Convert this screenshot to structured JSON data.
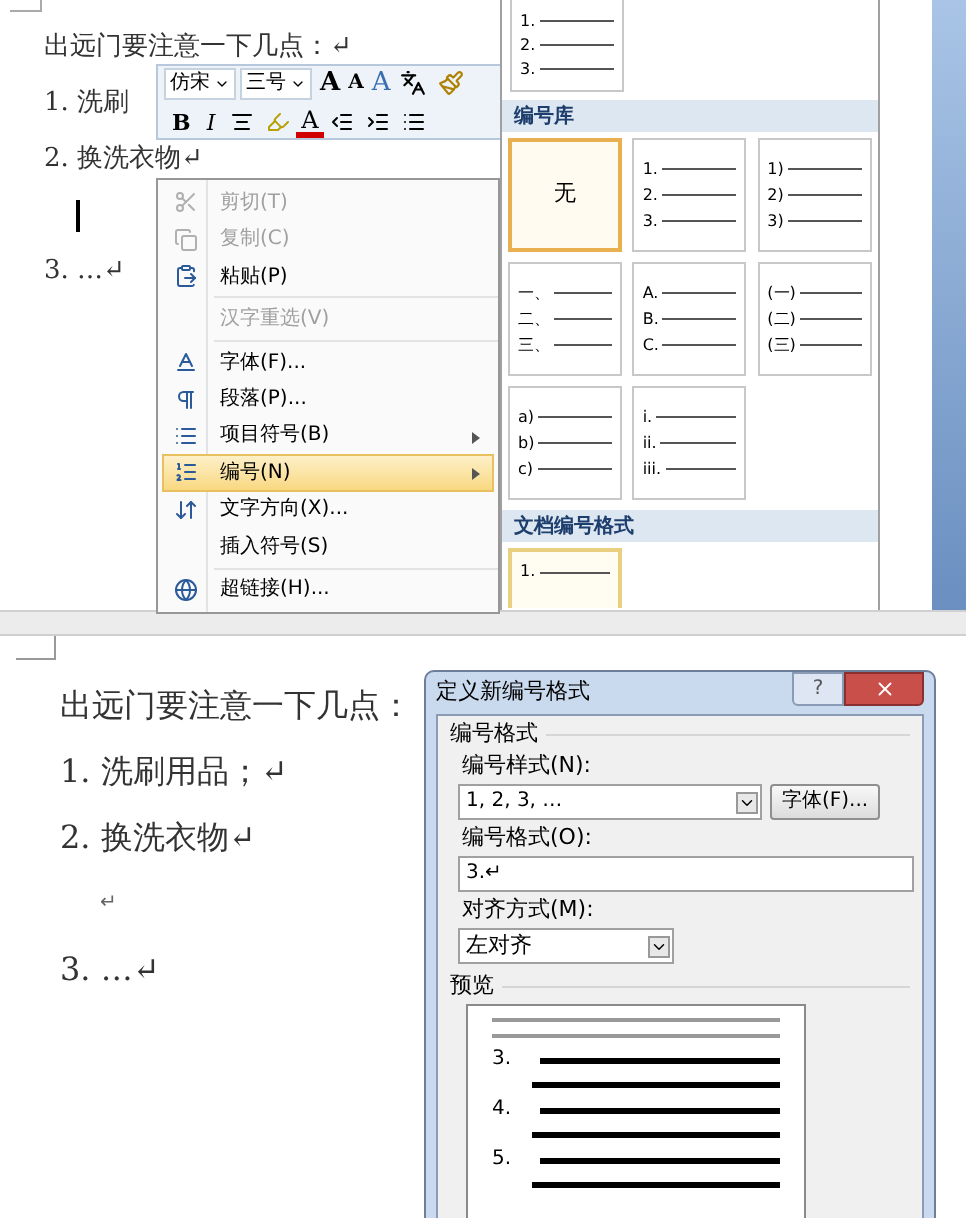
{
  "top": {
    "document": {
      "lines": [
        {
          "kind": "text",
          "text": "出远门要注意一下几点：↵"
        },
        {
          "kind": "text",
          "text": "1. 洗刷"
        },
        {
          "kind": "text",
          "text": "2. 换洗衣物↵"
        },
        {
          "kind": "cursor"
        },
        {
          "kind": "text",
          "text": "3. …↵"
        }
      ]
    },
    "mini_toolbar": {
      "row_1": [
        {
          "kind": "dropdown",
          "value": "仿宋"
        },
        {
          "kind": "dropdown",
          "value": "三号"
        },
        {
          "kind": "grow",
          "label": "A"
        },
        {
          "kind": "shrink",
          "label": "A"
        },
        {
          "kind": "styles",
          "label": "A"
        },
        {
          "kind": "phonetic"
        },
        {
          "kind": "painter"
        }
      ],
      "row_2": [
        {
          "kind": "bold",
          "label": "B"
        },
        {
          "kind": "italic",
          "label": "I"
        },
        {
          "kind": "center"
        },
        {
          "kind": "highlight"
        },
        {
          "kind": "color",
          "label": "A"
        },
        {
          "kind": "outdent"
        },
        {
          "kind": "indent"
        },
        {
          "kind": "bullets"
        }
      ]
    },
    "context_menu": {
      "items": [
        {
          "kind": "item",
          "label": "剪切(T)",
          "disabled": true,
          "submenu": false,
          "selected": false
        },
        {
          "kind": "item",
          "label": "复制(C)",
          "disabled": true,
          "submenu": false,
          "selected": false
        },
        {
          "kind": "item",
          "label": "粘贴(P)",
          "disabled": false,
          "submenu": false,
          "selected": false
        },
        {
          "kind": "separator"
        },
        {
          "kind": "item",
          "label": "汉字重选(V)",
          "disabled": true,
          "submenu": false,
          "selected": false
        },
        {
          "kind": "separator"
        },
        {
          "kind": "item",
          "label": "字体(F)...",
          "disabled": false,
          "submenu": false,
          "selected": false
        },
        {
          "kind": "item",
          "label": "段落(P)...",
          "disabled": false,
          "submenu": false,
          "selected": false
        },
        {
          "kind": "item",
          "label": "项目符号(B)",
          "disabled": false,
          "submenu": true,
          "selected": false
        },
        {
          "kind": "item",
          "label": "编号(N)",
          "disabled": false,
          "submenu": true,
          "selected": true
        },
        {
          "kind": "item",
          "label": "文字方向(X)...",
          "disabled": false,
          "submenu": false,
          "selected": false
        },
        {
          "kind": "item",
          "label": "插入符号(S)",
          "disabled": false,
          "submenu": false,
          "selected": false
        },
        {
          "kind": "separator"
        },
        {
          "kind": "item",
          "label": "超链接(H)...",
          "disabled": false,
          "submenu": false,
          "selected": false
        }
      ]
    },
    "numbering_gallery": {
      "recent": [
        {
          "kind": "list",
          "lines": [
            "1.",
            "2.",
            "3."
          ],
          "selected": false
        }
      ],
      "library_title": "编号库",
      "library": [
        {
          "kind": "none",
          "label": "无",
          "selected": true
        },
        {
          "kind": "list",
          "lines": [
            "1.",
            "2.",
            "3."
          ],
          "selected": false
        },
        {
          "kind": "list",
          "lines": [
            "1)",
            "2)",
            "3)"
          ],
          "selected": false
        },
        {
          "kind": "list",
          "lines": [
            "一、",
            "二、",
            "三、"
          ],
          "selected": false
        },
        {
          "kind": "list",
          "lines": [
            "A.",
            "B.",
            "C."
          ],
          "selected": false
        },
        {
          "kind": "list",
          "lines": [
            "(一)",
            "(二)",
            "(三)"
          ],
          "selected": false
        },
        {
          "kind": "list",
          "lines": [
            "a)",
            "b)",
            "c)"
          ],
          "selected": false
        },
        {
          "kind": "list",
          "lines": [
            "i.",
            "ii.",
            "iii."
          ],
          "selected": false
        }
      ],
      "document_title": "文档编号格式",
      "document_formats": [
        {
          "kind": "list",
          "lines": [
            "1."
          ],
          "selected": true
        }
      ]
    }
  },
  "bottom": {
    "document": {
      "lines": [
        {
          "kind": "text",
          "text": "出远门要注意一下几点："
        },
        {
          "kind": "text",
          "text": "1. 洗刷用品；↵"
        },
        {
          "kind": "text",
          "text": "2. 换洗衣物↵"
        },
        {
          "kind": "mark",
          "text": "↵"
        },
        {
          "kind": "text",
          "text": "3. …↵"
        }
      ]
    },
    "dialog": {
      "title": "定义新编号格式",
      "help": "?",
      "group": "编号格式",
      "style_label": "编号样式(N):",
      "style_value": "1, 2, 3, …",
      "font_button": "字体(F)...",
      "format_label": "编号格式(O):",
      "format_value": "3.↵",
      "align_label": "对齐方式(M):",
      "align_value": "左对齐",
      "preview_label": "预览",
      "preview_numbers": [
        "3.",
        "4.",
        "5."
      ]
    }
  }
}
